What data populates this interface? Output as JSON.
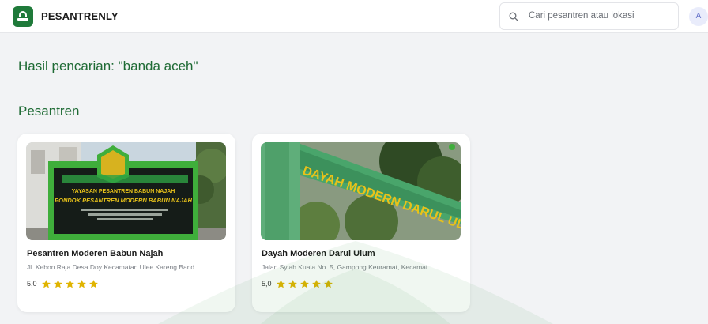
{
  "header": {
    "brand": "PESANTRENLY",
    "search_placeholder": "Cari pesantren atau lokasi",
    "avatar_initial": "A"
  },
  "results": {
    "heading": "Hasil pencarian: \"banda aceh\""
  },
  "section": {
    "heading": "Pesantren"
  },
  "cards": [
    {
      "title": "Pesantren Moderen Babun Najah",
      "address": "Jl. Kebon Raja Desa Doy Kecamatan Ulee Kareng Band...",
      "rating": "5,0",
      "stars": 5,
      "photo_sign_line1": "YAYASAN PESANTREN BABUN NAJAH",
      "photo_sign_line2": "PONDOK PESANTREN MODERN BABUN NAJAH"
    },
    {
      "title": "Dayah Moderen Darul Ulum",
      "address": "Jalan Syiah Kuala No. 5, Gampong Keuramat, Kecamat...",
      "rating": "5,0",
      "stars": 5,
      "photo_sign_text": "DAYAH MODERN DARUL ULUM"
    }
  ],
  "colors": {
    "brand_green": "#1f7a3a",
    "heading_green": "#1f6b35",
    "star_gold": "#e0b400"
  }
}
